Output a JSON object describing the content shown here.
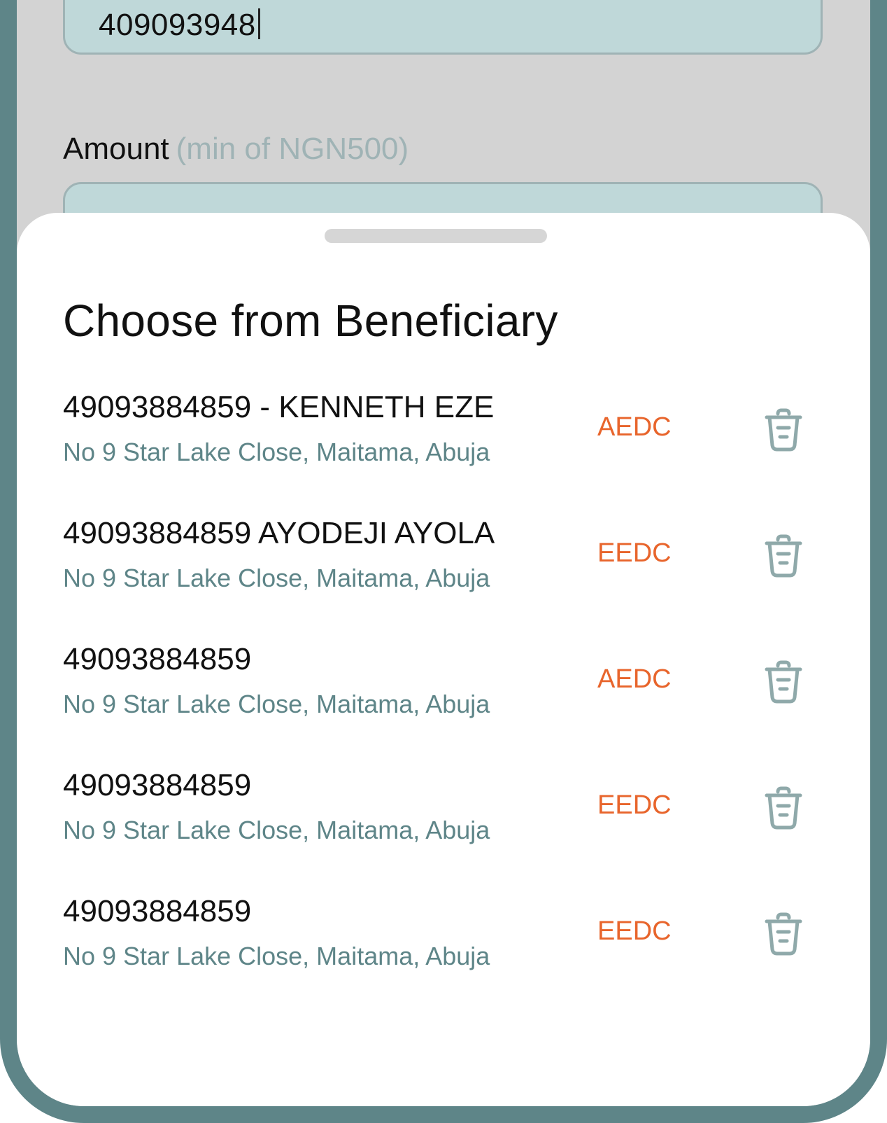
{
  "form": {
    "meter_number_value": "409093948",
    "amount_label": "Amount",
    "amount_hint": "(min of NGN500)",
    "amount_value": ""
  },
  "sheet": {
    "title": "Choose from Beneficiary",
    "items": [
      {
        "number": "49093884859",
        "separator": " - ",
        "name": "KENNETH EZE",
        "address": "No 9 Star Lake Close, Maitama, Abuja",
        "provider": "AEDC"
      },
      {
        "number": "49093884859",
        "separator": " ",
        "name": "AYODEJI AYOLA",
        "address": "No 9 Star Lake Close, Maitama, Abuja",
        "provider": "EEDC"
      },
      {
        "number": "49093884859",
        "separator": "",
        "name": "",
        "address": "No 9 Star Lake Close, Maitama, Abuja",
        "provider": "AEDC"
      },
      {
        "number": "49093884859",
        "separator": "",
        "name": "",
        "address": "No 9 Star Lake Close, Maitama, Abuja",
        "provider": "EEDC"
      },
      {
        "number": "49093884859",
        "separator": "",
        "name": "",
        "address": "No 9 Star Lake Close, Maitama, Abuja",
        "provider": "EEDC"
      }
    ]
  },
  "icons": {
    "delete": "trash-icon"
  },
  "colors": {
    "frame": "#5e8588",
    "input_fill": "#bfd8d9",
    "input_border": "#9fb3b5",
    "provider_text": "#e8652c",
    "address_text": "#5e8588",
    "icon": "#8fa9aa"
  }
}
